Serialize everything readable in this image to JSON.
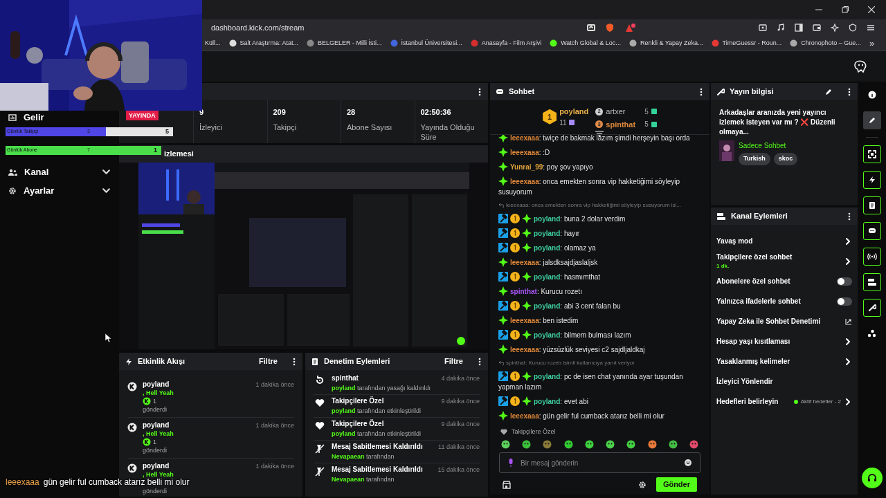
{
  "browser": {
    "url": "dashboard.kick.com/stream",
    "bookmarks": [
      "Küll...",
      "Salt Araştırma: Atat...",
      "BELGELER - Milli İsti...",
      "İstanbul Üniversitesi...",
      "Anasayfa - Film Arşivi",
      "Watch Global & Loc...",
      "Renkli & Yapay Zeka...",
      "TimeGuessr - Roun...",
      "Chronophoto – Gue..."
    ],
    "more": "»"
  },
  "sidebar": {
    "items": [
      {
        "label": "Gelir"
      },
      {
        "label": "Kanal",
        "expanded": false
      },
      {
        "label": "Ayarlar",
        "expanded": false
      }
    ]
  },
  "goal_bars": [
    {
      "label": "Günlük Takipçi",
      "current": "3",
      "target": "5",
      "level": 0.6,
      "color": "#4f46e5"
    },
    {
      "label": "Günlük Abone",
      "current": "7",
      "target": "1",
      "level": 1,
      "color": "#4ade4a"
    }
  ],
  "stats": {
    "status": "YAYINDA",
    "items": [
      {
        "value": "9",
        "label": "İzleyici"
      },
      {
        "value": "209",
        "label": "Takipçi"
      },
      {
        "value": "28",
        "label": "Abone Sayısı"
      },
      {
        "value": "02:50:36",
        "label": "Yayında Olduğu Süre"
      }
    ]
  },
  "preview": {
    "title": "izlemesi"
  },
  "activity": {
    "title": "Etkinlik Akışı",
    "filter": "Filtre",
    "events": [
      {
        "user": "poyland",
        "detail": ", Hell Yeah",
        "amount": "1",
        "action": "gönderdi",
        "time": "1 dakika önce"
      },
      {
        "user": "poyland",
        "detail": ", Hell Yeah",
        "amount": "1",
        "action": "gönderdi",
        "time": "1 dakika önce"
      },
      {
        "user": "poyland",
        "detail": ", Hell Yeah",
        "action": "gönderdi",
        "time": "1 dakika önce"
      }
    ]
  },
  "moderation": {
    "title": "Denetim Eylemleri",
    "filter": "Filtre",
    "actions": [
      {
        "kind": "unban",
        "title": "spinthat",
        "actor": "poyland",
        "text": "tarafından yasağı kaldırıldı",
        "time": "4 dakika önce"
      },
      {
        "kind": "followers",
        "title": "Takipçilere Özel",
        "actor": "poyland",
        "text": "tarafından etkinleştirildi",
        "time": "9 dakika önce"
      },
      {
        "kind": "followers",
        "title": "Takipçilere Özel",
        "actor": "poyland",
        "text": "tarafından etkinleştirildi",
        "time": "9 dakika önce"
      },
      {
        "kind": "unpin",
        "title": "Mesaj Sabitlemesi Kaldırıldı",
        "actor": "Nevapaean",
        "text": "tarafından",
        "time": "11 dakika önce"
      },
      {
        "kind": "unpin",
        "title": "Mesaj Sabitlemesi Kaldırıldı",
        "actor": "Nevapaean",
        "text": "tarafından",
        "time": "15 dakika önce"
      }
    ]
  },
  "chat": {
    "title": "Sohbet",
    "gifters": [
      {
        "rank": "1",
        "name": "poyland",
        "count": "11"
      },
      {
        "rank": "2",
        "name": "artxer",
        "count": "5"
      },
      {
        "rank": "3",
        "name": "spinthat",
        "count": "5"
      }
    ],
    "messages": [
      {
        "kind": "viewer",
        "user": "leeexaaa",
        "color": "#e0883a",
        "text": ": twiçe de bakmak lazım şimdi herşeyin başı orda"
      },
      {
        "kind": "viewer",
        "user": "leeexaaa",
        "color": "#e0883a",
        "text": ": :D"
      },
      {
        "kind": "viewer",
        "user": "Yunrai_99",
        "color": "#e0a23a",
        "text": ": poy şov yapıyo"
      },
      {
        "kind": "viewer",
        "user": "leeexaaa",
        "color": "#e0883a",
        "text": ": onca emekten sonra vip hakketiğimi söyleyip susuyorum"
      },
      {
        "kind": "reply",
        "text": "leeexaaa: onca emekten sonra vip hakketiğimi söyleyip susuyorum isl..."
      },
      {
        "kind": "moderator",
        "user": "poyland",
        "color": "#3fd0a0",
        "text": ": buna 2 dolar verdim"
      },
      {
        "kind": "moderator",
        "user": "poyland",
        "color": "#3fd0a0",
        "text": ": hayır"
      },
      {
        "kind": "moderator",
        "user": "poyland",
        "color": "#3fd0a0",
        "text": ": olamaz ya"
      },
      {
        "kind": "viewer",
        "user": "leeexaaa",
        "color": "#e0883a",
        "text": ": jalsdksajdjaslaljsk"
      },
      {
        "kind": "moderator",
        "user": "poyland",
        "color": "#3fd0a0",
        "text": ": hasmımthat"
      },
      {
        "kind": "viewer",
        "user": "spinthat",
        "color": "#a855f7",
        "text": ": Kurucu rozetı"
      },
      {
        "kind": "moderator",
        "user": "poyland",
        "color": "#3fd0a0",
        "text": ": abi 3 cent falan bu"
      },
      {
        "kind": "viewer",
        "user": "leeexaaa",
        "color": "#e0883a",
        "text": ": ben istedim"
      },
      {
        "kind": "moderator",
        "user": "poyland",
        "color": "#3fd0a0",
        "text": ": bilmem bulması lazım"
      },
      {
        "kind": "viewer",
        "user": "leeexaaa",
        "color": "#e0883a",
        "text": ": yüzsüzlük seviyesi c2 sajdljaldkaj"
      },
      {
        "kind": "reply",
        "text": "spinthat: Kurucu rozetı isimli kullanıcıya yanıt veriyor"
      },
      {
        "kind": "moderator",
        "user": "poyland",
        "color": "#3fd0a0",
        "text": ": pc de isen chat yanında ayar tuşundan yapman lazım"
      },
      {
        "kind": "moderator",
        "user": "poyland",
        "color": "#3fd0a0",
        "text": ": evet abi"
      },
      {
        "kind": "viewer",
        "user": "leeexaaa",
        "color": "#e0883a",
        "text": ": gün gelir ful cumback atarız belli mi olur"
      }
    ],
    "mode": "Takipçilere Özel",
    "placeholder": "Bir mesaj gönderin",
    "send": "Gönder"
  },
  "stream_info": {
    "title": "Yayın bilgisi",
    "description": "Arkadaşlar aranızda yeni yayıncı izlemek isteyen var mı ? ❌ Düzenli olmaya...",
    "category": "Sadece Sohbet",
    "tags": [
      "Turkish",
      "skoc"
    ]
  },
  "channel_actions": {
    "title": "Kanal Eylemleri",
    "items": [
      {
        "kind": "chevron",
        "label": "Yavaş mod"
      },
      {
        "kind": "chevron",
        "label": "Takipçilere özel sohbet",
        "sub": "1 dk."
      },
      {
        "kind": "toggle",
        "label": "Abonelere özel sohbet",
        "on": false
      },
      {
        "kind": "toggle",
        "label": "Yalnızca ifadelerle sohbet",
        "on": false
      },
      {
        "kind": "external",
        "label": "Yapay Zeka ile Sohbet Denetimi"
      },
      {
        "kind": "chevron",
        "label": "Hesap yaşı kısıtlaması"
      },
      {
        "kind": "chevron",
        "label": "Yasaklanmış kelimeler"
      },
      {
        "kind": "plain",
        "label": "İzleyici Yönlendir"
      },
      {
        "kind": "chevron",
        "label": "Hedefleri belirleyin",
        "status": "Aktif hedefler - 2"
      }
    ]
  },
  "rail": [
    {
      "selected": false
    },
    {
      "selected": true
    },
    {
      "selected": false
    },
    {
      "selected": false
    },
    {
      "selected": false
    },
    {
      "selected": false
    },
    {
      "selected": false
    },
    {
      "selected": false
    },
    {
      "selected": false
    },
    {
      "selected": false
    }
  ],
  "overlay_caption": {
    "user": "leeexaaa",
    "text": "gün gelir ful cumback atarız belli mi olur"
  }
}
